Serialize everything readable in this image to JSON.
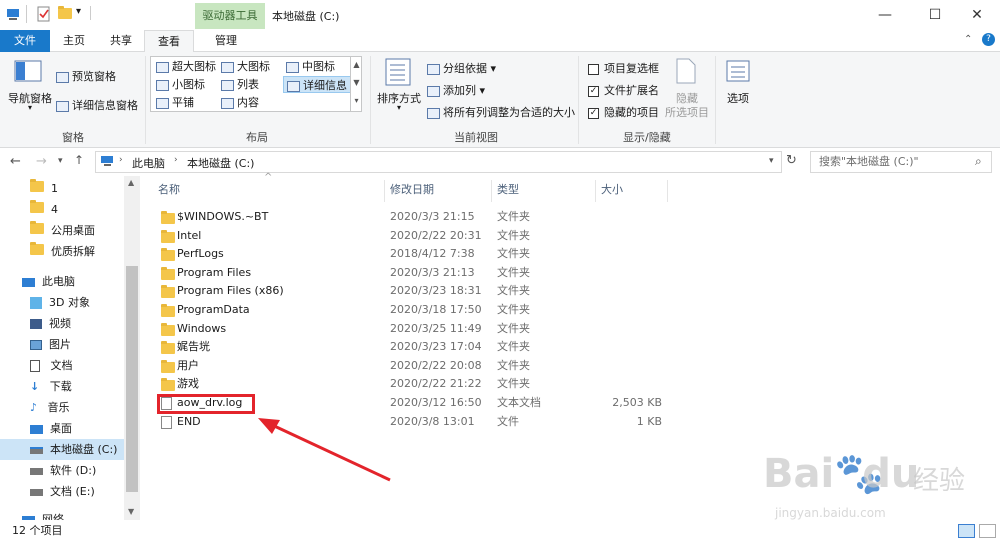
{
  "window": {
    "title": "本地磁盘 (C:)",
    "context_tab_header": "驱动器工具",
    "minimize": "—",
    "maximize": "☐",
    "close": "✕"
  },
  "tabs": {
    "file": "文件",
    "home": "主页",
    "share": "共享",
    "view": "查看",
    "manage": "管理"
  },
  "ribbon": {
    "panes": {
      "nav_pane": "导航窗格",
      "preview_pane": "预览窗格",
      "details_pane": "详细信息窗格",
      "label": "窗格"
    },
    "layout": {
      "items": [
        "超大图标",
        "大图标",
        "中图标",
        "小图标",
        "列表",
        "详细信息",
        "平铺",
        "内容"
      ],
      "label": "布局"
    },
    "current_view": {
      "sort_by": "排序方式",
      "group_by": "分组依据",
      "add_column": "添加列",
      "fit_columns": "将所有列调整为合适的大小",
      "label": "当前视图"
    },
    "show_hide": {
      "item_checkbox": "项目复选框",
      "item_checkbox_checked": false,
      "file_ext": "文件扩展名",
      "file_ext_checked": true,
      "hidden_items": "隐藏的项目",
      "hidden_items_checked": true,
      "hide_selected_1": "隐藏",
      "hide_selected_2": "所选项目",
      "label": "显示/隐藏"
    },
    "options": "选项"
  },
  "address": {
    "crumbs": [
      "此电脑",
      "本地磁盘 (C:)"
    ],
    "search_placeholder": "搜索\"本地磁盘 (C:)\""
  },
  "nav": {
    "items": [
      {
        "label": "1",
        "icon": "folder-icon"
      },
      {
        "label": "4",
        "icon": "folder-icon"
      },
      {
        "label": "公用桌面",
        "icon": "folder-icon"
      },
      {
        "label": "优质拆解",
        "icon": "folder-icon"
      },
      {
        "label": "此电脑",
        "icon": "pc-icon"
      },
      {
        "label": "3D 对象",
        "icon": "3d-objects-icon"
      },
      {
        "label": "视频",
        "icon": "video-icon"
      },
      {
        "label": "图片",
        "icon": "pictures-icon"
      },
      {
        "label": "文档",
        "icon": "documents-icon"
      },
      {
        "label": "下载",
        "icon": "download-icon"
      },
      {
        "label": "音乐",
        "icon": "music-icon"
      },
      {
        "label": "桌面",
        "icon": "desktop-icon"
      },
      {
        "label": "本地磁盘 (C:)",
        "icon": "drive-icon"
      },
      {
        "label": "软件 (D:)",
        "icon": "drive-icon"
      },
      {
        "label": "文档 (E:)",
        "icon": "drive-icon"
      },
      {
        "label": "网络",
        "icon": "network-icon"
      }
    ]
  },
  "columns": {
    "name": "名称",
    "date": "修改日期",
    "type": "类型",
    "size": "大小"
  },
  "files": [
    {
      "name": "$WINDOWS.~BT",
      "date": "2020/3/3 21:15",
      "type": "文件夹",
      "size": "",
      "kind": "folder"
    },
    {
      "name": "Intel",
      "date": "2020/2/22 20:31",
      "type": "文件夹",
      "size": "",
      "kind": "folder"
    },
    {
      "name": "PerfLogs",
      "date": "2018/4/12 7:38",
      "type": "文件夹",
      "size": "",
      "kind": "folder"
    },
    {
      "name": "Program Files",
      "date": "2020/3/3 21:13",
      "type": "文件夹",
      "size": "",
      "kind": "folder"
    },
    {
      "name": "Program Files (x86)",
      "date": "2020/3/23 18:31",
      "type": "文件夹",
      "size": "",
      "kind": "folder"
    },
    {
      "name": "ProgramData",
      "date": "2020/3/18 17:50",
      "type": "文件夹",
      "size": "",
      "kind": "folder"
    },
    {
      "name": "Windows",
      "date": "2020/3/25 11:49",
      "type": "文件夹",
      "size": "",
      "kind": "folder"
    },
    {
      "name": "娓告垙",
      "date": "2020/3/23 17:04",
      "type": "文件夹",
      "size": "",
      "kind": "folder"
    },
    {
      "name": "用户",
      "date": "2020/2/22 20:08",
      "type": "文件夹",
      "size": "",
      "kind": "folder"
    },
    {
      "name": "游戏",
      "date": "2020/2/22 21:22",
      "type": "文件夹",
      "size": "",
      "kind": "folder"
    },
    {
      "name": "aow_drv.log",
      "date": "2020/3/12 16:50",
      "type": "文本文档",
      "size": "2,503 KB",
      "kind": "doc"
    },
    {
      "name": "END",
      "date": "2020/3/8 13:01",
      "type": "文件",
      "size": "1 KB",
      "kind": "doc"
    }
  ],
  "status": {
    "count": "12 个项目"
  },
  "annotation": {
    "color": "#e3242b"
  },
  "watermark": {
    "brand": "Bai",
    "brand2": "du",
    "cn": "经验",
    "url": "jingyan.baidu.com"
  }
}
